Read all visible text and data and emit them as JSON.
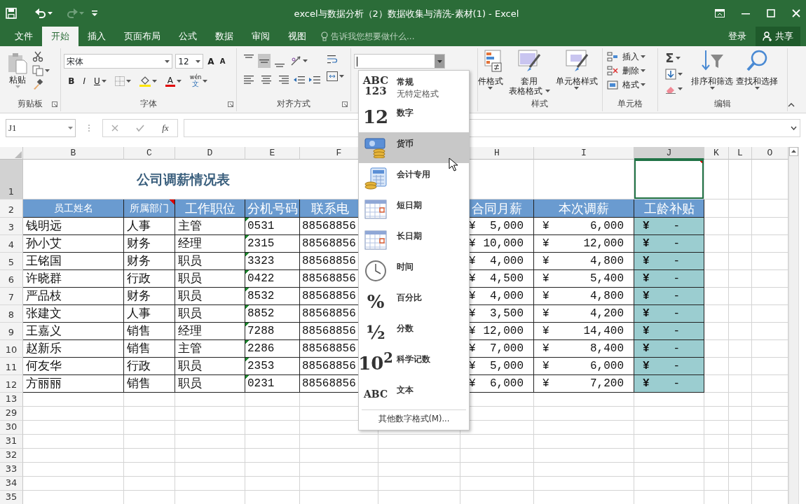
{
  "window": {
    "title": "excel与数据分析（2）数据收集与清洗-素材(1) - Excel"
  },
  "menu": {
    "tabs": [
      {
        "label": "文件",
        "selected": false
      },
      {
        "label": "开始",
        "selected": true
      },
      {
        "label": "插入",
        "selected": false
      },
      {
        "label": "页面布局",
        "selected": false
      },
      {
        "label": "公式",
        "selected": false
      },
      {
        "label": "数据",
        "selected": false
      },
      {
        "label": "审阅",
        "selected": false
      },
      {
        "label": "视图",
        "selected": false
      }
    ],
    "tell_me": "告诉我您想要做什么...",
    "sign_in": "登录",
    "share": "共享"
  },
  "ribbon": {
    "clipboard": {
      "paste": "粘贴",
      "label": "剪贴板"
    },
    "font": {
      "font_name": "宋体",
      "font_size": "12",
      "grow": "A",
      "shrink": "A",
      "bold": "B",
      "italic": "I",
      "underline": "U",
      "font_color": "A",
      "phonetic_top": "wén",
      "phonetic_bottom": "文",
      "label": "字体"
    },
    "alignment": {
      "label": "对齐方式",
      "vertical_align": [
        {
          "kind": "top",
          "selected": false
        },
        {
          "kind": "middle",
          "selected": true
        },
        {
          "kind": "bottom",
          "selected": false
        }
      ]
    },
    "styles": {
      "conditional": "件格式",
      "table_format": [
        "套用",
        "表格格式"
      ],
      "cell_styles": "单元格样式",
      "label": "样式"
    },
    "cells": {
      "items": [
        "插入",
        "删除",
        "格式"
      ],
      "label": "单元格"
    },
    "editing": {
      "autosum": "Σ",
      "sort": "排序和筛选",
      "find": "查找和选择",
      "label": "编辑"
    }
  },
  "formula_bar": {
    "name_box": "J1",
    "function_label": "fx"
  },
  "sheet": {
    "columns": [
      {
        "label": "B",
        "selected": false
      },
      {
        "label": "C",
        "selected": false
      },
      {
        "label": "D",
        "selected": false
      },
      {
        "label": "E",
        "selected": false
      },
      {
        "label": "F",
        "selected": false
      },
      {
        "label": "H",
        "selected": false
      },
      {
        "label": "I",
        "selected": false
      },
      {
        "label": "J",
        "selected": true
      },
      {
        "label": "K",
        "selected": false
      },
      {
        "label": "L",
        "selected": false
      },
      {
        "label": "O",
        "selected": false
      }
    ],
    "rows": [
      {
        "label": "1",
        "selected": true
      },
      {
        "label": "2",
        "selected": false
      },
      {
        "label": "3",
        "selected": false
      },
      {
        "label": "4",
        "selected": false
      },
      {
        "label": "5",
        "selected": false
      },
      {
        "label": "6",
        "selected": false
      },
      {
        "label": "7",
        "selected": false
      },
      {
        "label": "8",
        "selected": false
      },
      {
        "label": "9",
        "selected": false
      },
      {
        "label": "10",
        "selected": false
      },
      {
        "label": "11",
        "selected": false
      },
      {
        "label": "12",
        "selected": false
      },
      {
        "label": "13",
        "selected": false
      },
      {
        "label": "29",
        "selected": false
      },
      {
        "label": "30",
        "selected": false
      },
      {
        "label": "31",
        "selected": false
      },
      {
        "label": "32",
        "selected": false
      },
      {
        "label": "33",
        "selected": false
      },
      {
        "label": "34",
        "selected": false
      },
      {
        "label": "35",
        "selected": false
      }
    ],
    "title": "公司调薪情况表",
    "active_cell_comment": true,
    "headers": [
      {
        "label": "员工姓名",
        "comment": false
      },
      {
        "label": "所属部门",
        "comment": true
      },
      {
        "label": "工作职位",
        "comment": false
      },
      {
        "label": "分机号码",
        "comment": false
      },
      {
        "label": "联系电"
      },
      {
        "label": "合同月薪",
        "comment": false
      },
      {
        "label": "本次调薪",
        "comment": false
      },
      {
        "label": "工龄补贴",
        "comment": false
      }
    ],
    "records": [
      {
        "name": "钱明远",
        "dept": "人事",
        "position": "主管",
        "ext": "0531",
        "ext_flag": true,
        "phone": "88568856",
        "salary": {
          "symbol": "¥",
          "value": "5,000"
        },
        "raise": {
          "symbol": "¥",
          "value": "6,000"
        },
        "allowance": {
          "symbol": "¥",
          "value": "-"
        }
      },
      {
        "name": "孙小艾",
        "dept": "财务",
        "position": "经理",
        "ext": "2315",
        "ext_flag": true,
        "phone": "88568856",
        "salary": {
          "symbol": "¥",
          "value": "10,000"
        },
        "raise": {
          "symbol": "¥",
          "value": "12,000"
        },
        "allowance": {
          "symbol": "¥",
          "value": "-"
        }
      },
      {
        "name": "王铭国",
        "dept": "财务",
        "position": "职员",
        "ext": "3323",
        "ext_flag": true,
        "phone": "88568856",
        "salary": {
          "symbol": "¥",
          "value": "4,000"
        },
        "raise": {
          "symbol": "¥",
          "value": "4,800"
        },
        "allowance": {
          "symbol": "¥",
          "value": "-"
        }
      },
      {
        "name": "许晓群",
        "dept": "行政",
        "position": "职员",
        "ext": "0422",
        "ext_flag": true,
        "phone": "88568856",
        "salary": {
          "symbol": "¥",
          "value": "4,500"
        },
        "raise": {
          "symbol": "¥",
          "value": "5,400"
        },
        "allowance": {
          "symbol": "¥",
          "value": "-"
        }
      },
      {
        "name": "严品枝",
        "dept": "财务",
        "position": "职员",
        "ext": "8532",
        "ext_flag": true,
        "phone": "88568856",
        "salary": {
          "symbol": "¥",
          "value": "4,000"
        },
        "raise": {
          "symbol": "¥",
          "value": "4,800"
        },
        "allowance": {
          "symbol": "¥",
          "value": "-"
        }
      },
      {
        "name": "张建文",
        "dept": "人事",
        "position": "职员",
        "ext": "8852",
        "ext_flag": true,
        "phone": "88568856",
        "salary": {
          "symbol": "¥",
          "value": "3,500"
        },
        "raise": {
          "symbol": "¥",
          "value": "4,200"
        },
        "allowance": {
          "symbol": "¥",
          "value": "-"
        }
      },
      {
        "name": "王嘉义",
        "dept": "销售",
        "position": "经理",
        "ext": "7288",
        "ext_flag": true,
        "phone": "88568856",
        "salary": {
          "symbol": "¥",
          "value": "12,000"
        },
        "raise": {
          "symbol": "¥",
          "value": "14,400"
        },
        "allowance": {
          "symbol": "¥",
          "value": "-"
        }
      },
      {
        "name": "赵新乐",
        "dept": "销售",
        "position": "主管",
        "ext": "2286",
        "ext_flag": true,
        "phone": "88568856",
        "salary": {
          "symbol": "¥",
          "value": "7,000"
        },
        "raise": {
          "symbol": "¥",
          "value": "8,400"
        },
        "allowance": {
          "symbol": "¥",
          "value": "-"
        }
      },
      {
        "name": "何友华",
        "dept": "行政",
        "position": "职员",
        "ext": "2353",
        "ext_flag": true,
        "phone": "88568856",
        "salary": {
          "symbol": "¥",
          "value": "5,000"
        },
        "raise": {
          "symbol": "¥",
          "value": "6,000"
        },
        "allowance": {
          "symbol": "¥",
          "value": "-"
        }
      },
      {
        "name": "方丽丽",
        "dept": "销售",
        "position": "职员",
        "ext": "0231",
        "ext_flag": true,
        "phone": "88568856",
        "salary": {
          "symbol": "¥",
          "value": "6,000"
        },
        "raise": {
          "symbol": "¥",
          "value": "7,200"
        },
        "allowance": {
          "symbol": "¥",
          "value": "-"
        }
      }
    ]
  },
  "number_format_menu": {
    "items": [
      {
        "kind": "general",
        "label": "常规",
        "detail": "无特定格式",
        "icon_text": [
          "ABC",
          "123"
        ],
        "selected": false
      },
      {
        "kind": "number",
        "label": "数字",
        "icon_text": [
          "12"
        ],
        "selected": false
      },
      {
        "kind": "currency",
        "label": "货币",
        "selected": true
      },
      {
        "kind": "accounting",
        "label": "会计专用",
        "selected": false
      },
      {
        "kind": "short_date",
        "label": "短日期",
        "selected": false
      },
      {
        "kind": "long_date",
        "label": "长日期",
        "selected": false
      },
      {
        "kind": "time",
        "label": "时间",
        "selected": false
      },
      {
        "kind": "percent",
        "label": "百分比",
        "icon_text": [
          "%"
        ],
        "selected": false
      },
      {
        "kind": "fraction",
        "label": "分数",
        "icon_text": [
          "½"
        ],
        "selected": false
      },
      {
        "kind": "scientific",
        "label": "科学记数",
        "icon_text": [
          "10$^{2}$"
        ],
        "selected": false
      },
      {
        "kind": "text",
        "label": "文本",
        "icon_text": [
          "ABC"
        ],
        "selected": false
      }
    ],
    "more": "其他数字格式(M)..."
  }
}
